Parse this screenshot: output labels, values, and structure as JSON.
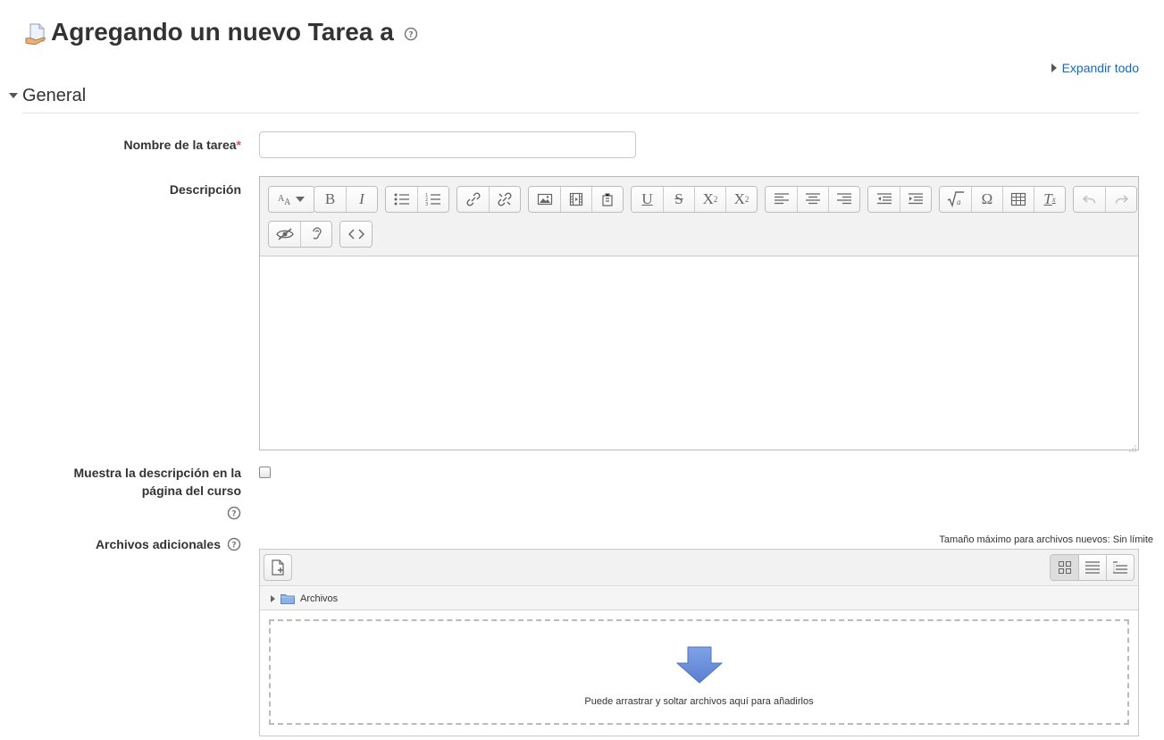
{
  "header": {
    "title": "Agregando un nuevo Tarea a",
    "expand_all": "Expandir todo"
  },
  "section": {
    "title": "General"
  },
  "form": {
    "name_label": "Nombre de la tarea",
    "required_mark": "*",
    "name_value": "",
    "description_label": "Descripción",
    "show_desc_label_line1": "Muestra la descripción en la",
    "show_desc_label_line2": "página del curso",
    "show_desc_checked": false,
    "files_label": "Archivos adicionales"
  },
  "editor": {
    "toolbar_row1": [
      [
        "font-size-icon"
      ],
      [
        "bold-icon",
        "italic-icon"
      ],
      [
        "unordered-list-icon",
        "ordered-list-icon"
      ],
      [
        "link-icon",
        "unlink-icon"
      ],
      [
        "image-icon",
        "media-icon",
        "manage-files-icon"
      ],
      [
        "underline-icon",
        "strikethrough-icon",
        "subscript-icon",
        "superscript-icon"
      ],
      [
        "align-left-icon",
        "align-center-icon",
        "align-right-icon"
      ],
      [
        "outdent-icon",
        "indent-icon"
      ],
      [
        "equation-icon",
        "special-character-icon",
        "table-icon",
        "clear-formatting-icon"
      ],
      [
        "undo-icon",
        "redo-icon"
      ]
    ],
    "toolbar_row2": [
      [
        "accessibility-checker-icon",
        "screenreader-helper-icon"
      ],
      [
        "html-source-icon"
      ]
    ],
    "bold_glyph": "B",
    "italic_glyph": "I",
    "underline_glyph": "U",
    "strike_glyph": "S",
    "subscript_glyph": "X",
    "subscript_index": "2",
    "superscript_glyph": "X",
    "superscript_index": "2",
    "omega_glyph": "Ω",
    "clear_glyph": "T",
    "clear_index": "x",
    "content": ""
  },
  "filemanager": {
    "max_size": "Tamaño máximo para archivos nuevos: Sin límite",
    "folder": "Archivos",
    "drop_text": "Puede arrastrar y soltar archivos aquí para añadirlos"
  },
  "colors": {
    "link": "#0f6cbf",
    "required": "#d9534f",
    "toolbar_bg": "#f2f2f2",
    "drop_arrow": "#6a8fd8"
  }
}
